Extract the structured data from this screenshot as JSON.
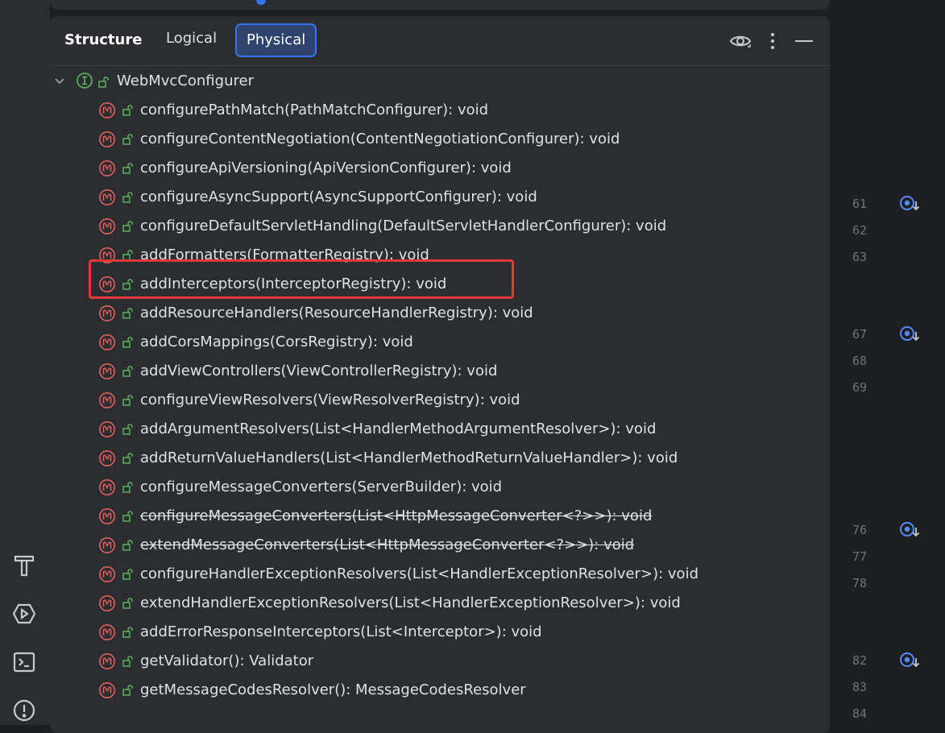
{
  "panel": {
    "title": "Structure",
    "tabs": [
      {
        "label": "Logical",
        "active": false
      },
      {
        "label": "Physical",
        "active": true
      }
    ],
    "header_icons": [
      "eye-icon",
      "more-vertical-icon",
      "minimize-icon"
    ]
  },
  "tree": {
    "root": {
      "label": "WebMvcConfigurer",
      "icon": "interface-icon",
      "expanded": true
    },
    "items": [
      {
        "label": "configurePathMatch(PathMatchConfigurer): void",
        "deprecated": false
      },
      {
        "label": "configureContentNegotiation(ContentNegotiationConfigurer): void",
        "deprecated": false
      },
      {
        "label": "configureApiVersioning(ApiVersionConfigurer): void",
        "deprecated": false
      },
      {
        "label": "configureAsyncSupport(AsyncSupportConfigurer): void",
        "deprecated": false
      },
      {
        "label": "configureDefaultServletHandling(DefaultServletHandlerConfigurer): void",
        "deprecated": false
      },
      {
        "label": "addFormatters(FormatterRegistry): void",
        "deprecated": false
      },
      {
        "label": "addInterceptors(InterceptorRegistry): void",
        "deprecated": false,
        "highlighted": true
      },
      {
        "label": "addResourceHandlers(ResourceHandlerRegistry): void",
        "deprecated": false
      },
      {
        "label": "addCorsMappings(CorsRegistry): void",
        "deprecated": false
      },
      {
        "label": "addViewControllers(ViewControllerRegistry): void",
        "deprecated": false
      },
      {
        "label": "configureViewResolvers(ViewResolverRegistry): void",
        "deprecated": false
      },
      {
        "label": "addArgumentResolvers(List<HandlerMethodArgumentResolver>): void",
        "deprecated": false
      },
      {
        "label": "addReturnValueHandlers(List<HandlerMethodReturnValueHandler>): void",
        "deprecated": false
      },
      {
        "label": "configureMessageConverters(ServerBuilder): void",
        "deprecated": false
      },
      {
        "label": "configureMessageConverters(List<HttpMessageConverter<?>>): void",
        "deprecated": true
      },
      {
        "label": "extendMessageConverters(List<HttpMessageConverter<?>>): void",
        "deprecated": true
      },
      {
        "label": "configureHandlerExceptionResolvers(List<HandlerExceptionResolver>): void",
        "deprecated": false
      },
      {
        "label": "extendHandlerExceptionResolvers(List<HandlerExceptionResolver>): void",
        "deprecated": false
      },
      {
        "label": "addErrorResponseInterceptors(List<Interceptor>): void",
        "deprecated": false
      },
      {
        "label": "getValidator(): Validator",
        "deprecated": false
      },
      {
        "label": "getMessageCodesResolver(): MessageCodesResolver",
        "deprecated": false
      }
    ]
  },
  "gutter": {
    "line_numbers": [
      "61",
      "62",
      "63",
      "67",
      "68",
      "69",
      "76",
      "77",
      "78",
      "82",
      "83",
      "84"
    ],
    "implementation_markers": [
      "61",
      "67",
      "76",
      "82"
    ]
  },
  "sidebar": {
    "icons": [
      "build-icon",
      "services-icon",
      "terminal-icon",
      "problems-icon"
    ]
  },
  "colors": {
    "accent": "#3574f0",
    "method_icon": "#e0605f",
    "interface_icon": "#5fb865",
    "highlight_box": "#e5383b"
  }
}
